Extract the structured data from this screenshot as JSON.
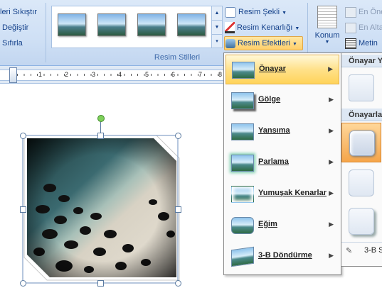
{
  "ribbon": {
    "adjust": {
      "compress_label": "leri Sıkıştır",
      "change_label": "Değiştir",
      "reset_label": "Sıfırla"
    },
    "styles_group_label": "Resim Stilleri",
    "shape_label": "Resim Şekli",
    "border_label": "Resim Kenarlığı",
    "effects_label": "Resim Efektleri",
    "arrange": {
      "position_label": "Konum",
      "front_label": "En Öne",
      "back_label": "En Alta",
      "wrap_label": "Metin"
    }
  },
  "ruler": {
    "numbers": [
      "1",
      "2",
      "3",
      "4",
      "5",
      "6",
      "7",
      "8"
    ]
  },
  "effects_menu": {
    "items": [
      {
        "label": "Önayar"
      },
      {
        "label": "Gölge"
      },
      {
        "label": "Yansıma"
      },
      {
        "label": "Parlama"
      },
      {
        "label": "Yumuşak Kenarlar"
      },
      {
        "label": "Eğim"
      },
      {
        "label": "3-B Döndürme"
      }
    ],
    "arrow_glyph": "▶"
  },
  "preset_submenu": {
    "header_none": "Önayar Y",
    "header_presets": "Önayarla",
    "footer_label": "3-B S"
  },
  "colors": {
    "accent": "#15428b",
    "highlight": "#ffd35a"
  }
}
